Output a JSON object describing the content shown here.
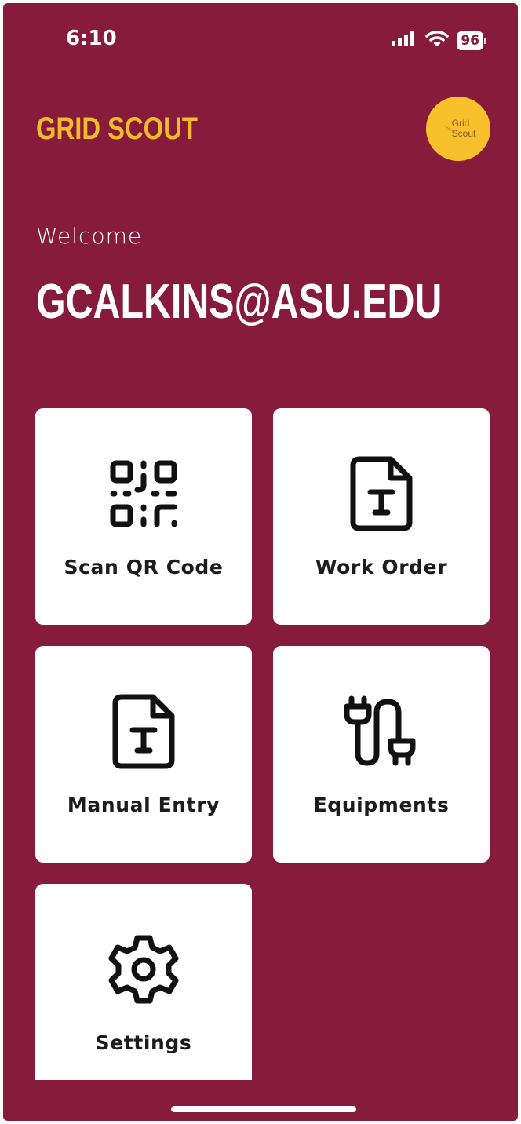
{
  "status_bar": {
    "time": "6:10",
    "battery": "96",
    "icons": [
      "signal-icon",
      "wifi-icon",
      "battery-icon"
    ]
  },
  "header": {
    "app_title": "GRID SCOUT",
    "logo_line1": "Grid",
    "logo_line2": "Scout"
  },
  "greeting": {
    "welcome": "Welcome",
    "user": "GCALKINS@ASU.EDU"
  },
  "tiles": [
    {
      "label": "Scan QR Code",
      "icon": "qr-code-icon"
    },
    {
      "label": "Work Order",
      "icon": "document-icon"
    },
    {
      "label": "Manual Entry",
      "icon": "document-icon"
    },
    {
      "label": "Equipments",
      "icon": "plug-icon"
    },
    {
      "label": "Settings",
      "icon": "gear-icon"
    }
  ],
  "colors": {
    "background": "#861b3c",
    "accent": "#f6b92a",
    "tile": "#ffffff"
  }
}
